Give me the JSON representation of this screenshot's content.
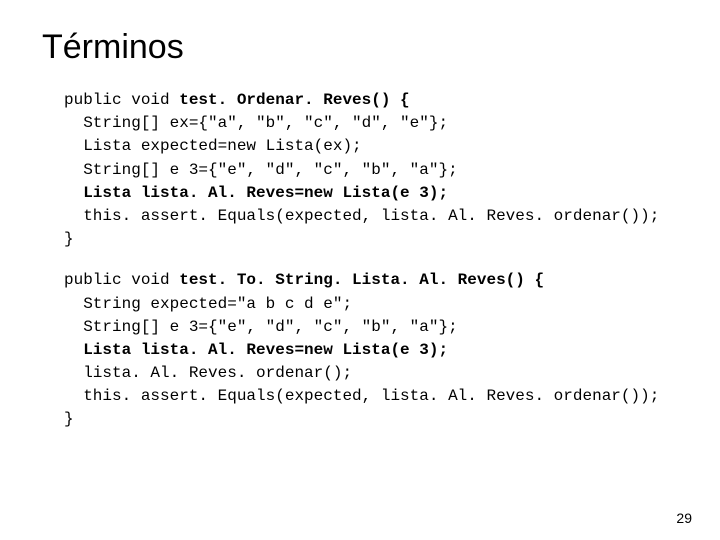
{
  "title": "Términos",
  "code1": {
    "l1a": "public void ",
    "l1b": "test. Ordenar. Reves() {",
    "l2": "  String[] ex={\"a\", \"b\", \"c\", \"d\", \"e\"};",
    "l3": "  Lista expected=new Lista(ex);",
    "l4": "  String[] e 3={\"e\", \"d\", \"c\", \"b\", \"a\"};",
    "l5": "  Lista lista. Al. Reves=new Lista(e 3);",
    "l6": "  this. assert. Equals(expected, lista. Al. Reves. ordenar());",
    "l7": "}"
  },
  "code2": {
    "l1a": "public void ",
    "l1b": "test. To. String. Lista. Al. Reves() {",
    "l2": "  String expected=\"a b c d e\";",
    "l3": "  String[] e 3={\"e\", \"d\", \"c\", \"b\", \"a\"};",
    "l4": "  Lista lista. Al. Reves=new Lista(e 3);",
    "l5": "  lista. Al. Reves. ordenar();",
    "l6": "  this. assert. Equals(expected, lista. Al. Reves. ordenar());",
    "l7": "}"
  },
  "pageNumber": "29"
}
